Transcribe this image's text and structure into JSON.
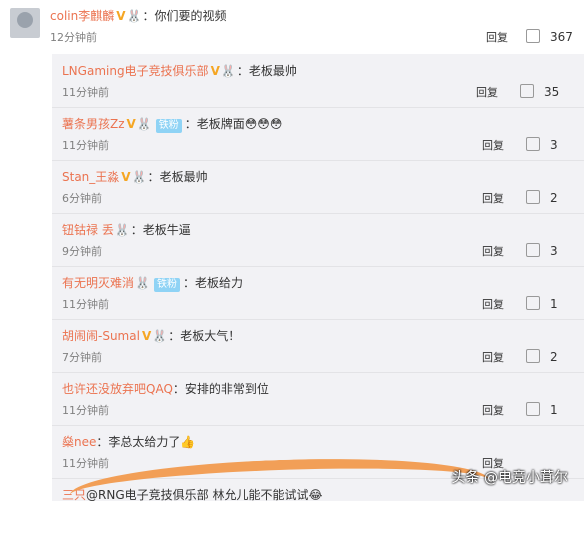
{
  "main_comment": {
    "username": "colin李麒麟",
    "text": "你们要的视频",
    "time": "12分钟前",
    "reply": "回复",
    "likes": "367"
  },
  "replies": [
    {
      "username": "LNGaming电子竞技俱乐部",
      "badge": "V",
      "text": "老板最帅",
      "time": "11分钟前",
      "reply": "回复",
      "likes": "35"
    },
    {
      "username": "薯条男孩Zz",
      "badge": "V",
      "fan": "铁粉",
      "text": "老板牌面😳😳😳",
      "time": "11分钟前",
      "reply": "回复",
      "likes": "3"
    },
    {
      "username": "Stan_王淼",
      "badge": "V",
      "text": "老板最帅",
      "time": "6分钟前",
      "reply": "回复",
      "likes": "2"
    },
    {
      "username": "钮钴禄 丢",
      "text": "老板牛逼",
      "time": "9分钟前",
      "reply": "回复",
      "likes": "3"
    },
    {
      "username": "有无明灭难消",
      "fan": "铁粉",
      "text": "老板给力",
      "time": "11分钟前",
      "reply": "回复",
      "likes": "1"
    },
    {
      "username": "胡闹闹-Sumal",
      "badge": "V",
      "text": "老板大气！",
      "time": "7分钟前",
      "reply": "回复",
      "likes": "2"
    },
    {
      "username": "也许还没放弃吧QAQ",
      "text": "安排的非常到位",
      "time": "11分钟前",
      "reply": "回复",
      "likes": "1"
    },
    {
      "username": "燊nee",
      "text": "李总太给力了👍",
      "time": "11分钟前",
      "reply": "回复",
      "likes": ""
    },
    {
      "username": "三只",
      "text": "@RNG电子竞技俱乐部 林允儿能不能试试😂"
    }
  ],
  "watermark": "头条 @电竞小茸尔"
}
